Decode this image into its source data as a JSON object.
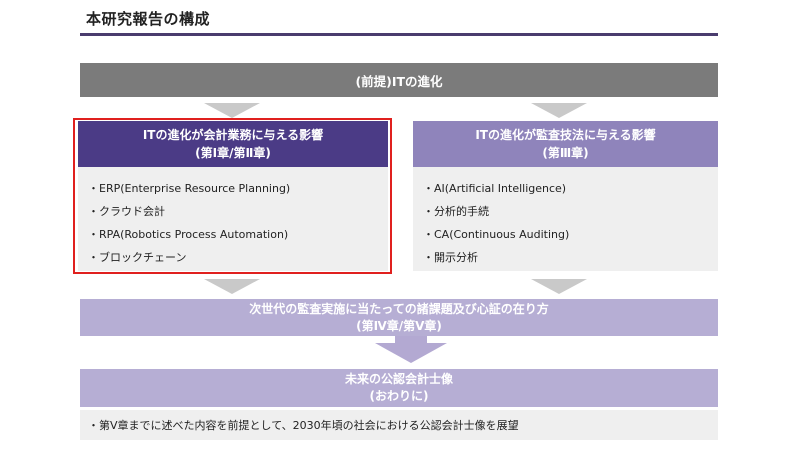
{
  "page": {
    "title": "本研究報告の構成"
  },
  "premise": {
    "label": "(前提)ITの進化"
  },
  "left_panel": {
    "title": "ITの進化が会計業務に与える影響",
    "subtitle": "(第Ⅰ章/第Ⅱ章)",
    "items": [
      "・ERP(Enterprise Resource Planning)",
      "・クラウド会計",
      "・RPA(Robotics Process Automation)",
      "・ブロックチェーン"
    ]
  },
  "right_panel": {
    "title": "ITの進化が監査技法に与える影響",
    "subtitle": "(第Ⅲ章)",
    "items": [
      "・AI(Artificial Intelligence)",
      "・分析的手続",
      "・CA(Continuous Auditing)",
      "・開示分析"
    ]
  },
  "future": {
    "title": "次世代の監査実施に当たっての諸課題及び心証の在り方",
    "subtitle": "(第Ⅳ章/第Ⅴ章)"
  },
  "closing": {
    "title": "未来の公認会計士像",
    "subtitle": "(おわりに)",
    "note": "・第Ⅴ章までに述べた内容を前提として、2030年頃の社会における公認会計士像を展望"
  },
  "colors": {
    "accent_dark": "#4b3b86",
    "accent_mid": "#8f84bb",
    "accent_light": "#b6aed4",
    "premise_gray": "#7b7b7b",
    "highlight_red": "#e0201e",
    "panel_bg": "#efefef"
  }
}
